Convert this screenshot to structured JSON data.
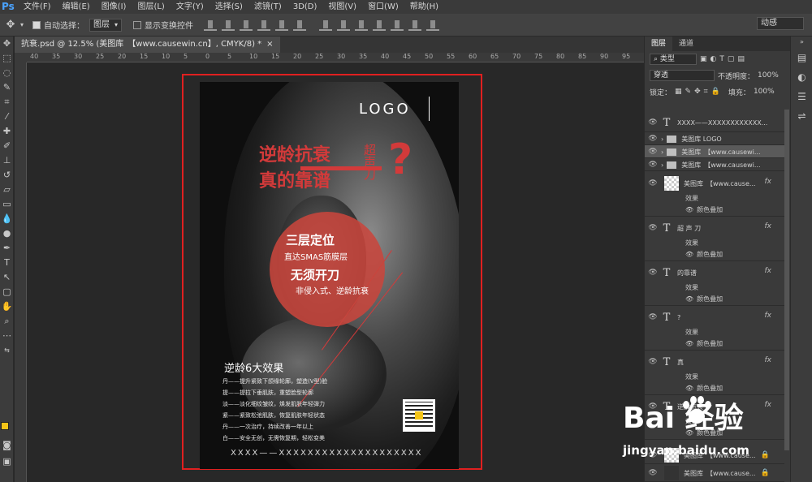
{
  "app_logo": "Ps",
  "menu": [
    "文件(F)",
    "编辑(E)",
    "图像(I)",
    "图层(L)",
    "文字(Y)",
    "选择(S)",
    "滤镜(T)",
    "3D(D)",
    "视图(V)",
    "窗口(W)",
    "帮助(H)"
  ],
  "options": {
    "auto_select_label": "自动选择：",
    "auto_select_value": "图层",
    "transform_controls_label": "显示变换控件",
    "workspace": "动感"
  },
  "document_tab": {
    "title": "抗衰.psd @ 12.5% (美图库　【www.causewin.cn】, CMYK/8) *",
    "close": "×"
  },
  "ruler_ticks": [
    "40",
    "35",
    "30",
    "25",
    "20",
    "15",
    "10",
    "5",
    "0",
    "5",
    "10",
    "15",
    "20",
    "25",
    "30",
    "35",
    "40",
    "45",
    "50",
    "55",
    "60",
    "65",
    "70",
    "75",
    "80",
    "85",
    "90",
    "95"
  ],
  "poster": {
    "logo": "LOGO",
    "title_line1": "逆龄抗衰",
    "title_line2": "真的靠谱",
    "side_text": "超声刀",
    "question_mark": "?",
    "circle_line1": "三层定位",
    "circle_line2": "直达SMAS筋膜层",
    "circle_line3": "无须开刀",
    "circle_line4": "非侵入式、逆龄抗衰",
    "effects_title": "逆龄6大效果",
    "effects_lines": [
      "丹——提升紧致下颌缘轮廓，塑造(V型)脸",
      "提——提拉下垂肌肤，重塑脸型轮廓",
      "淡——淡化细纹皱纹，焕发肌肤年轻弹力",
      "紧——紧致松弛肌肤，恢复肌肤年轻状态",
      "丹——一次治疗，持续改善一年以上",
      "白——安全无创，无需恢复期，轻松变美"
    ],
    "footer": "XXXX——XXXXXXXXXXXXXXXXXXXX"
  },
  "panel": {
    "tabs": [
      "图层",
      "通道"
    ],
    "kind_label": "类型",
    "blend_mode": "穿透",
    "opacity_label": "不透明度：",
    "opacity_value": "100%",
    "lock_label": "锁定：",
    "fill_label": "填充：",
    "fill_value": "100%"
  },
  "layers": [
    {
      "type": "text",
      "name": "XXXX——XXXXXXXXXXXX..."
    },
    {
      "type": "folder",
      "name": "美图库 LOGO"
    },
    {
      "type": "folder",
      "name": "美图库　【www.causewi..."
    },
    {
      "type": "folder",
      "name": "美图库　【www.causewi..."
    },
    {
      "type": "image",
      "name": "美图库　【www.cause...",
      "fx": "fx",
      "effects_label": "效果",
      "effect": "颜色叠加"
    },
    {
      "type": "text",
      "name": "超 声 刀",
      "fx": "fx",
      "effects_label": "效果",
      "effect": "颜色叠加"
    },
    {
      "type": "text",
      "name": "的靠谱",
      "fx": "fx",
      "effects_label": "效果",
      "effect": "颜色叠加"
    },
    {
      "type": "text",
      "name": "?",
      "fx": "fx",
      "effects_label": "效果",
      "effect": "颜色叠加"
    },
    {
      "type": "text",
      "name": "真",
      "fx": "fx",
      "effects_label": "效果",
      "effect": "颜色叠加"
    },
    {
      "type": "text",
      "name": "逆龄抗衰",
      "fx": "fx",
      "effects_label": "效果",
      "effect": "颜色叠加"
    },
    {
      "type": "image",
      "name": "美图库　【www.cause..."
    },
    {
      "type": "image",
      "name": "美图库　【www.cause..."
    }
  ],
  "watermark": {
    "main": "Bai 经验",
    "sub": "jingyan.baidu.com"
  }
}
